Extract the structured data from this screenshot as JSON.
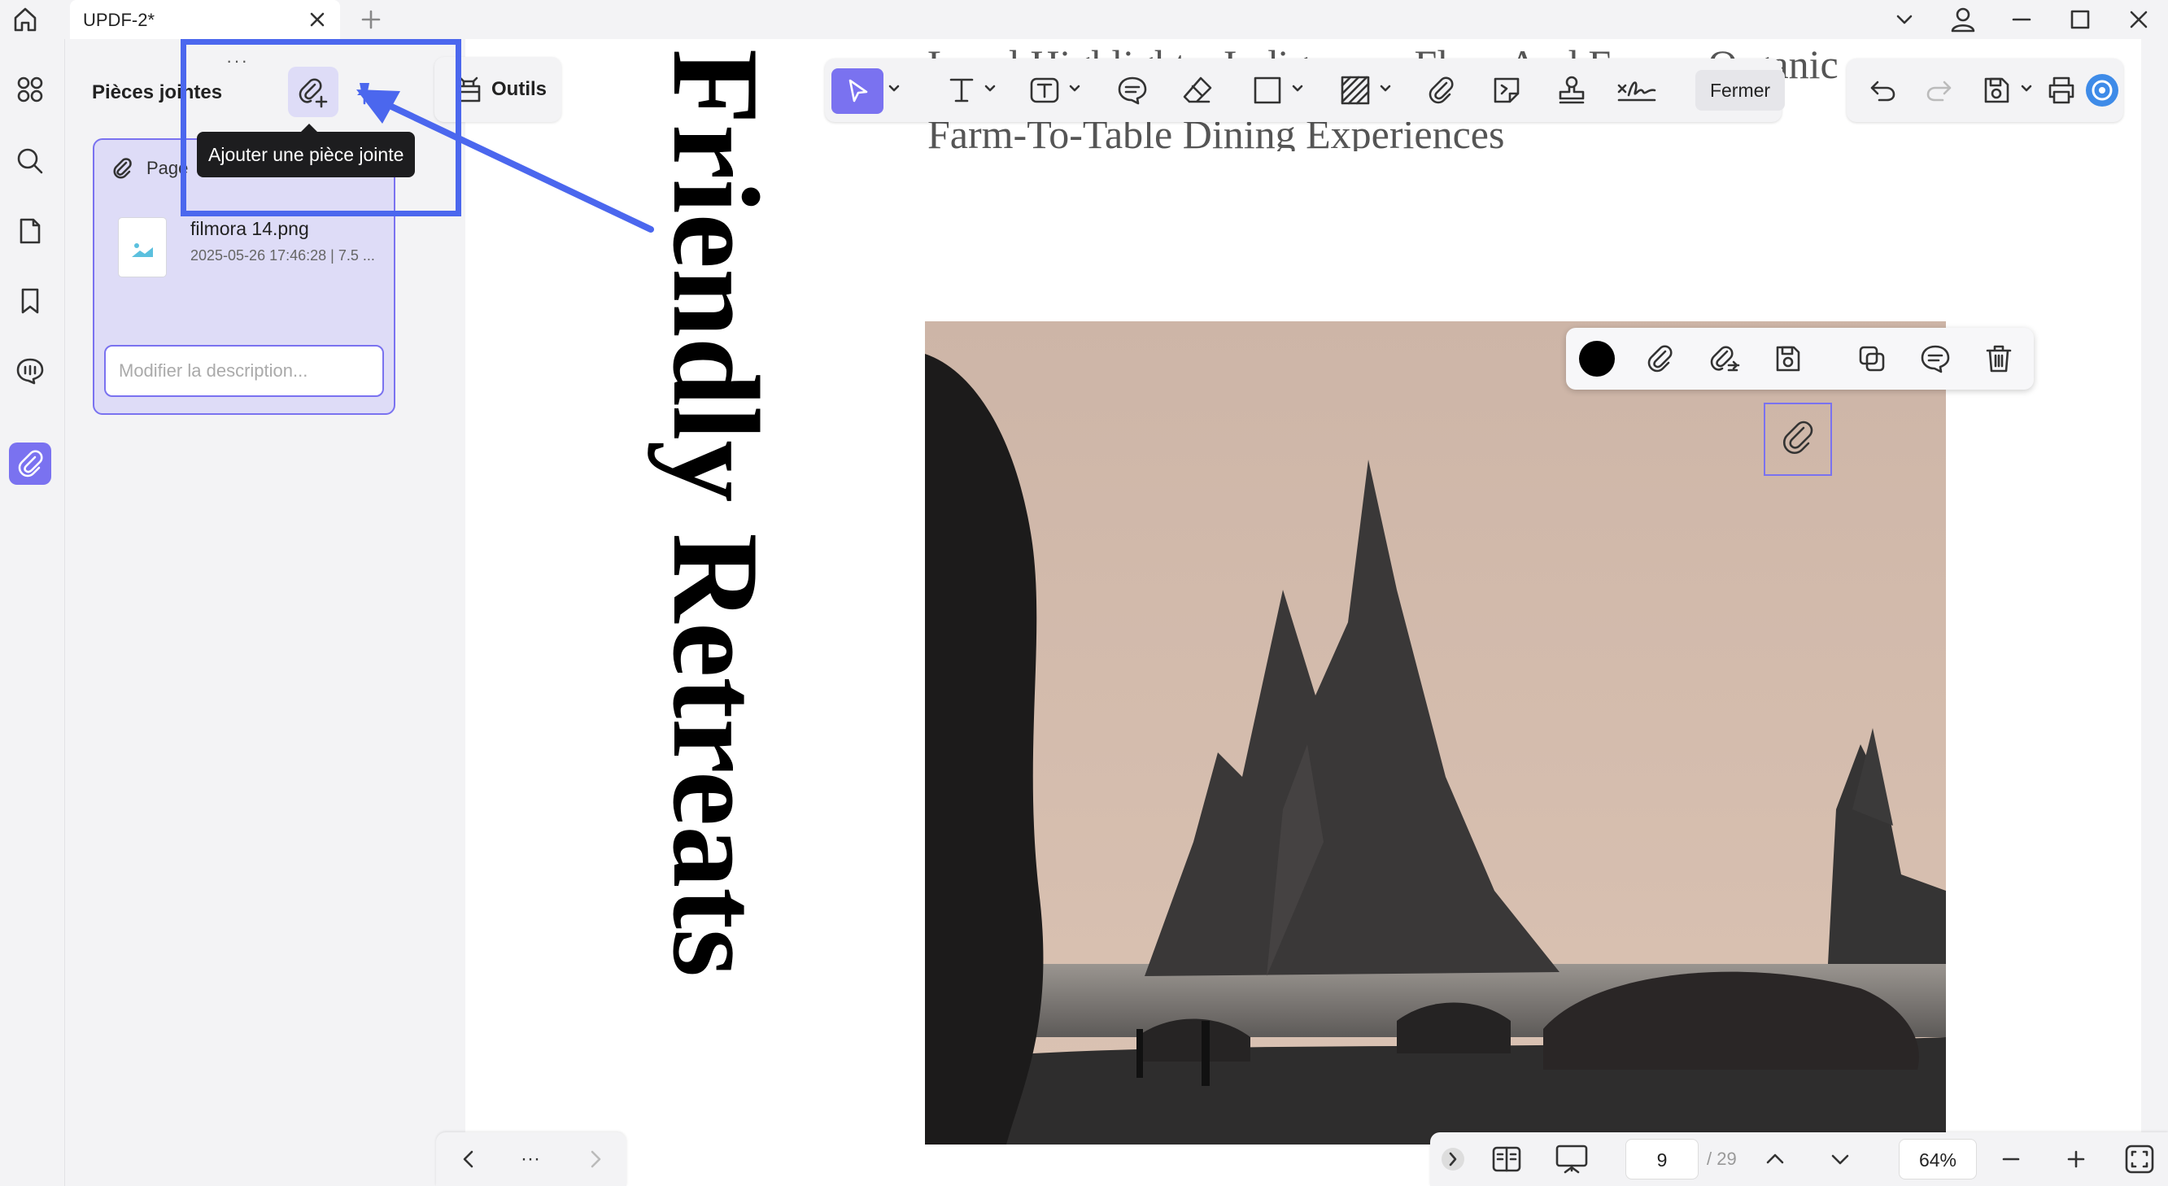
{
  "tabs": [
    {
      "title": "UPDF-2*"
    }
  ],
  "panel": {
    "title": "Pièces jointes",
    "more": "···",
    "tooltip": "Ajouter une pièce jointe",
    "attachment": {
      "page_label": "Page",
      "file_name": "filmora 14.png",
      "meta": "2025-05-26 17:46:28 | 7.5 ...",
      "description_placeholder": "Modifier la description..."
    }
  },
  "toolbar": {
    "tools_label": "Outils",
    "close_label": "Fermer"
  },
  "document": {
    "heading_line1": "Local Highlights: Indigenous Flora And Fauna. Organic",
    "heading_line2": "Farm-To-Table Dining Experiences",
    "vertical_title": "Friendly Retreats"
  },
  "status": {
    "current_page": "9",
    "total_pages": "/ 29",
    "zoom": "64%",
    "nav_more": "···"
  },
  "colors": {
    "accent": "#7a72f0",
    "annotation_blue": "#4b67ee",
    "selected_color": "#000000"
  }
}
